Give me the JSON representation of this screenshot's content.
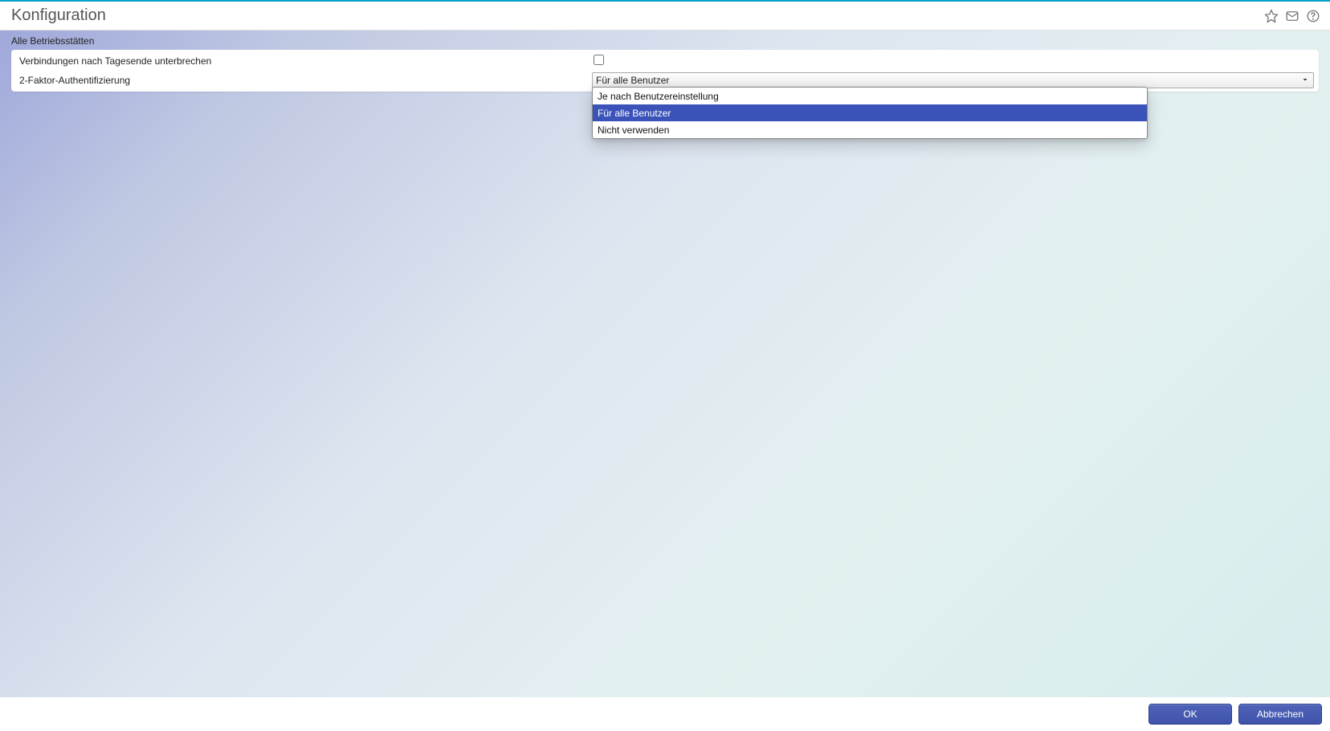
{
  "header": {
    "title": "Konfiguration"
  },
  "section": {
    "label": "Alle Betriebsstätten"
  },
  "settings": {
    "disconnect_label": "Verbindungen nach Tagesende unterbrechen",
    "disconnect_checked": false,
    "twofa_label": "2-Faktor-Authentifizierung",
    "twofa_selected": "Für alle Benutzer",
    "twofa_options": {
      "0": "Je nach Benutzereinstellung",
      "1": "Für alle Benutzer",
      "2": "Nicht verwenden"
    },
    "twofa_selected_index": 1
  },
  "footer": {
    "ok": "OK",
    "cancel": "Abbrechen"
  }
}
